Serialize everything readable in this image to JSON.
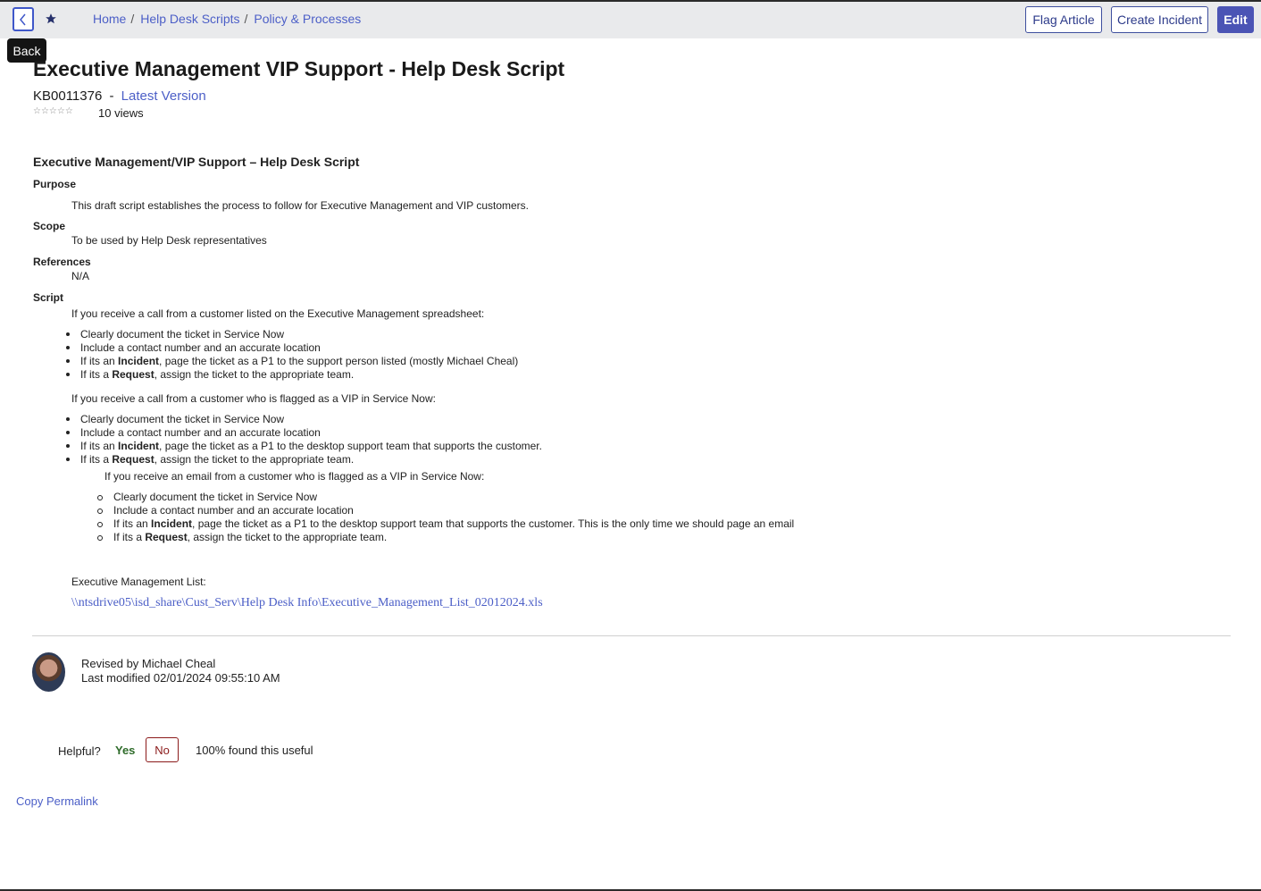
{
  "header": {
    "back_tooltip": "Back",
    "breadcrumb": [
      "Home",
      "Help Desk Scripts",
      "Policy & Processes"
    ],
    "buttons": {
      "flag": "Flag Article",
      "create_incident": "Create Incident",
      "edit": "Edit"
    }
  },
  "article": {
    "title": "Executive Management VIP Support - Help Desk Script",
    "number": "KB0011376",
    "dash": "-",
    "version": "Latest Version",
    "rating": "☆☆☆☆☆",
    "views": "10 views",
    "heading": "Executive Management/VIP Support – Help Desk Script",
    "purpose_label": "Purpose",
    "purpose_text": "This draft script establishes the process to follow for Executive Management and VIP customers.",
    "scope_label": "Scope",
    "scope_text": "To be used by Help Desk representatives",
    "references_label": "References",
    "references_text": "N/A",
    "script_label": "Script",
    "intro1": "If you receive a call from a customer listed on the Executive Management spreadsheet:",
    "list1": [
      "Clearly document the ticket in Service Now",
      "Include a contact number and an accurate location",
      "If its an **Incident**, page the ticket as a P1 to the support person listed (mostly Michael Cheal)",
      "If its a **Request**, assign the ticket to the appropriate team."
    ],
    "intro2": "If you receive a call from a customer who is flagged as a VIP in Service Now:",
    "list2": [
      "Clearly document the ticket in Service Now",
      "Include a contact number and an accurate location",
      "If its an **Incident**, page the ticket as a P1 to the desktop support team that supports the customer.",
      "If its a **Request**, assign the ticket to the appropriate team."
    ],
    "intro3": "If you receive an email from a customer who is flagged as a VIP in Service Now:",
    "list3": [
      "Clearly document the ticket in Service Now",
      "Include a contact number and an accurate location",
      "If its an **Incident**, page the ticket as a P1 to the desktop support team that supports the customer. This is the only time we should page an email",
      "If its a **Request**, assign the ticket to the appropriate team."
    ],
    "exec_list_label": "Executive Management List:",
    "exec_list_link": "\\\\ntsdrive05\\isd_share\\Cust_Serv\\Help Desk Info\\Executive_Management_List_02012024.xls"
  },
  "footer": {
    "revised_by": "Revised by Michael Cheal",
    "last_modified": "Last modified 02/01/2024 09:55:10 AM",
    "helpful_label": "Helpful?",
    "yes": "Yes",
    "no": "No",
    "useful": "100% found this useful",
    "permalink": "Copy Permalink"
  },
  "colors": {
    "accent": "#4c5fc7",
    "edit_bg": "#4b54b5",
    "no_border": "#8b1a1a",
    "yes_text": "#2e6b2a"
  }
}
